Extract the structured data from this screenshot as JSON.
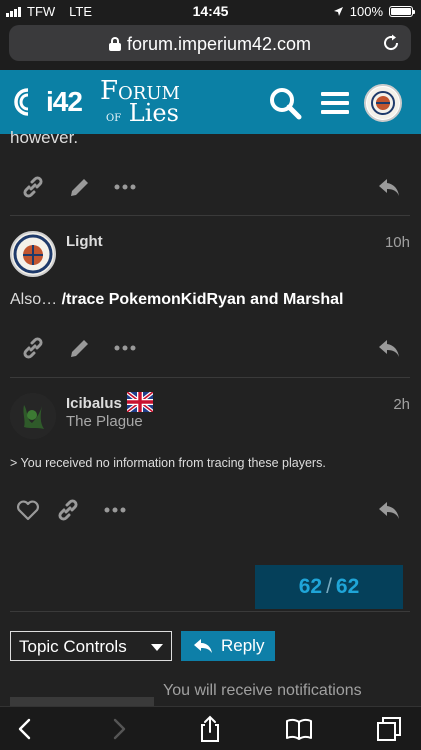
{
  "status_bar": {
    "carrier": "TFW",
    "network": "LTE",
    "time": "14:45",
    "battery": "100%"
  },
  "browser": {
    "url": "forum.imperium42.com"
  },
  "site_header": {
    "logo_text": "i42",
    "forum_line1": "Forum",
    "forum_of": "of",
    "forum_line2": "Lies"
  },
  "cut_text": "however.",
  "posts": [
    {
      "username": "Light",
      "time": "10h",
      "body_prefix": "Also… ",
      "body_bold": "/trace PokemonKidRyan and Marshal"
    },
    {
      "username": "Icibalus",
      "user_title": "The Plague",
      "time": "2h",
      "body": "> You received no information from tracing these players."
    }
  ],
  "progress": {
    "current": "62",
    "separator": "/",
    "total": "62"
  },
  "topic_controls": {
    "label": "Topic Controls"
  },
  "reply_button": {
    "label": "Reply"
  },
  "notification_text": "You will receive notifications",
  "colors": {
    "brand": "#0b80a5",
    "background": "#222222",
    "progress_bg": "#05405a",
    "progress_text": "#1fa5d8"
  },
  "icons": [
    "lock-icon",
    "reload-icon",
    "search-icon",
    "hamburger-icon",
    "link-icon",
    "pencil-icon",
    "more-icon",
    "reply-icon",
    "heart-icon",
    "uk-flag-icon",
    "back-icon",
    "forward-icon",
    "share-icon",
    "bookmarks-icon",
    "tabs-icon"
  ]
}
